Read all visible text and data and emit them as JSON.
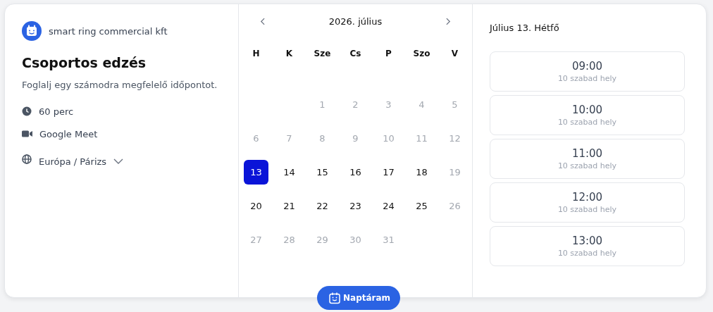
{
  "organizer": {
    "name": "smart ring commercial kft"
  },
  "event": {
    "title": "Csoportos edzés",
    "description": "Foglalj egy számodra megfelelő időpontot."
  },
  "details": [
    {
      "kind": "duration",
      "label": "60 perc"
    },
    {
      "kind": "video",
      "label": "Google Meet"
    },
    {
      "kind": "timezone",
      "label": "Európa / Párizs"
    }
  ],
  "calendar": {
    "month": "2026. július",
    "weekdays": [
      "H",
      "K",
      "Sze",
      "Cs",
      "P",
      "Szo",
      "V"
    ],
    "days": [
      {
        "label": "1",
        "disabled": true,
        "selected": false
      },
      {
        "label": "2",
        "disabled": true,
        "selected": false
      },
      {
        "label": "3",
        "disabled": true,
        "selected": false
      },
      {
        "label": "4",
        "disabled": true,
        "selected": false
      },
      {
        "label": "5",
        "disabled": true,
        "selected": false
      },
      {
        "label": "6",
        "disabled": true,
        "selected": false
      },
      {
        "label": "7",
        "disabled": true,
        "selected": false
      },
      {
        "label": "8",
        "disabled": true,
        "selected": false
      },
      {
        "label": "9",
        "disabled": true,
        "selected": false
      },
      {
        "label": "10",
        "disabled": true,
        "selected": false
      },
      {
        "label": "11",
        "disabled": true,
        "selected": false
      },
      {
        "label": "12",
        "disabled": true,
        "selected": false
      },
      {
        "label": "13",
        "disabled": false,
        "selected": true
      },
      {
        "label": "14",
        "disabled": false,
        "selected": false
      },
      {
        "label": "15",
        "disabled": false,
        "selected": false
      },
      {
        "label": "16",
        "disabled": false,
        "selected": false
      },
      {
        "label": "17",
        "disabled": false,
        "selected": false
      },
      {
        "label": "18",
        "disabled": false,
        "selected": false
      },
      {
        "label": "19",
        "disabled": true,
        "selected": false
      },
      {
        "label": "20",
        "disabled": false,
        "selected": false
      },
      {
        "label": "21",
        "disabled": false,
        "selected": false
      },
      {
        "label": "22",
        "disabled": false,
        "selected": false
      },
      {
        "label": "23",
        "disabled": false,
        "selected": false
      },
      {
        "label": "24",
        "disabled": false,
        "selected": false
      },
      {
        "label": "25",
        "disabled": false,
        "selected": false
      },
      {
        "label": "26",
        "disabled": true,
        "selected": false
      },
      {
        "label": "27",
        "disabled": true,
        "selected": false
      },
      {
        "label": "28",
        "disabled": true,
        "selected": false
      },
      {
        "label": "29",
        "disabled": true,
        "selected": false
      },
      {
        "label": "30",
        "disabled": true,
        "selected": false
      },
      {
        "label": "31",
        "disabled": true,
        "selected": false
      }
    ]
  },
  "slots": {
    "date": "Július 13. Hétfő",
    "items": [
      {
        "time": "09:00",
        "seats": "10 szabad hely"
      },
      {
        "time": "10:00",
        "seats": "10 szabad hely"
      },
      {
        "time": "11:00",
        "seats": "10 szabad hely"
      },
      {
        "time": "12:00",
        "seats": "10 szabad hely"
      },
      {
        "time": "13:00",
        "seats": "10 szabad hely"
      }
    ]
  },
  "floating_button": {
    "label": "Naptáram"
  }
}
